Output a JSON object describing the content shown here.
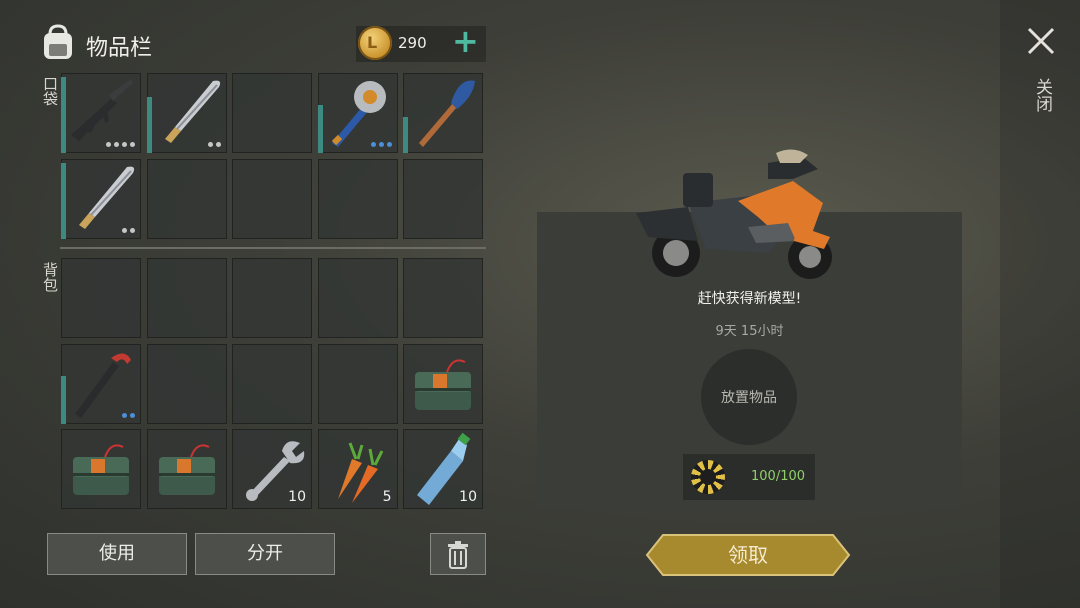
{
  "inventory": {
    "title": "物品栏",
    "coins": "290",
    "pockets_label": "口袋",
    "backpack_label": "背包",
    "pockets": [
      {
        "name": "assault-rifle",
        "dots": 4,
        "dur": 0.95,
        "count": ""
      },
      {
        "name": "machete",
        "dots": 2,
        "dur": 0.7,
        "count": ""
      },
      {
        "name": "empty",
        "dots": 0,
        "dur": 0,
        "count": ""
      },
      {
        "name": "saw-mace",
        "dots": 3,
        "dur": 0.6,
        "blue": true,
        "count": ""
      },
      {
        "name": "oar",
        "dots": 0,
        "dur": 0.45,
        "count": ""
      },
      {
        "name": "machete",
        "dots": 2,
        "dur": 0.95,
        "count": ""
      },
      {
        "name": "empty",
        "dots": 0,
        "dur": 0,
        "count": ""
      },
      {
        "name": "empty",
        "dots": 0,
        "dur": 0,
        "count": ""
      },
      {
        "name": "empty",
        "dots": 0,
        "dur": 0,
        "count": ""
      },
      {
        "name": "empty",
        "dots": 0,
        "dur": 0,
        "count": ""
      }
    ],
    "backpack": [
      {
        "name": "empty",
        "count": ""
      },
      {
        "name": "empty",
        "count": ""
      },
      {
        "name": "empty",
        "count": ""
      },
      {
        "name": "empty",
        "count": ""
      },
      {
        "name": "empty",
        "count": ""
      },
      {
        "name": "crowbar",
        "dots": 2,
        "dur": 0.6,
        "blue": true,
        "count": ""
      },
      {
        "name": "empty",
        "count": ""
      },
      {
        "name": "empty",
        "count": ""
      },
      {
        "name": "empty",
        "count": ""
      },
      {
        "name": "explosive",
        "count": ""
      },
      {
        "name": "explosive",
        "count": ""
      },
      {
        "name": "explosive",
        "count": ""
      },
      {
        "name": "wrench",
        "count": "10"
      },
      {
        "name": "carrot",
        "count": "5"
      },
      {
        "name": "water-bottle",
        "count": "10"
      }
    ],
    "use_label": "使用",
    "split_label": "分开"
  },
  "panel": {
    "promo": "赶快获得新模型!",
    "timer": "9天 15小时",
    "place_label": "放置物品",
    "chip_progress": "100/100",
    "claim_label": "领取"
  },
  "close_label": "关闭",
  "colors": {
    "accent": "#3d8a82",
    "claim": "#a88a2e",
    "chip_text": "#8fd06a"
  }
}
